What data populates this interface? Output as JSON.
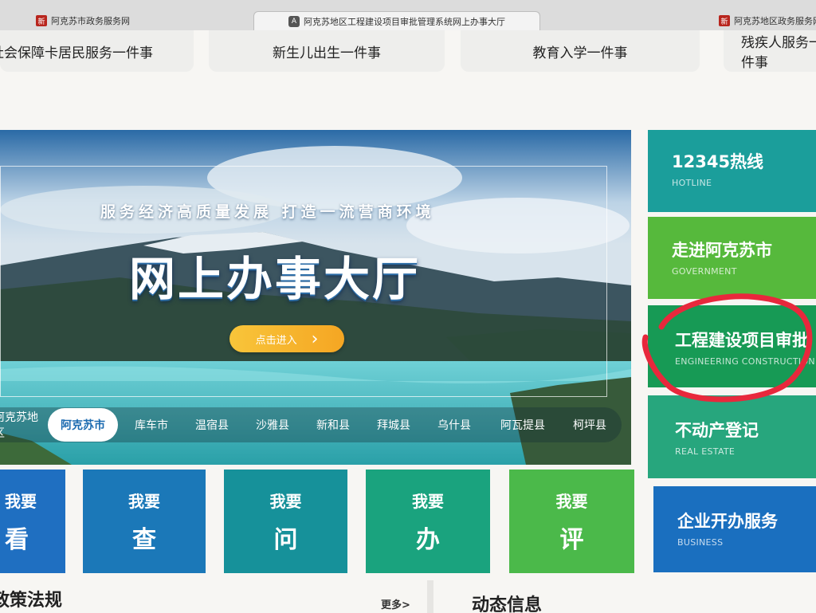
{
  "browser": {
    "tabs": [
      {
        "label": "阿克苏市政务服务网",
        "favicon": "xin-logo-red"
      },
      {
        "label": "阿克苏地区工程建设项目审批管理系统网上办事大厅",
        "favicon": "A-icon"
      },
      {
        "label": "阿克苏地区政务服务网",
        "favicon": "xin-logo-red"
      }
    ]
  },
  "top_cards": [
    "社会保障卡居民服务一件事",
    "新生儿出生一件事",
    "教育入学一件事",
    "残疾人服务一件事"
  ],
  "banner": {
    "slogan": "服务经济高质量发展  打造一流营商环境",
    "title": "网上办事大厅",
    "enter_button": "点击进入",
    "enter_arrow": "›"
  },
  "regions": [
    "阿克苏地区",
    "阿克苏市",
    "库车市",
    "温宿县",
    "沙雅县",
    "新和县",
    "拜城县",
    "乌什县",
    "阿瓦提县",
    "柯坪县"
  ],
  "active_region": "阿克苏市",
  "tiles": [
    {
      "line1": "我要",
      "line2": "看",
      "color": "#1f6fc1"
    },
    {
      "line1": "我要",
      "line2": "查",
      "color": "#1b78b8"
    },
    {
      "line1": "我要",
      "line2": "问",
      "color": "#16919a"
    },
    {
      "line1": "我要",
      "line2": "办",
      "color": "#1aa37e"
    },
    {
      "line1": "我要",
      "line2": "评",
      "color": "#4bb94a"
    }
  ],
  "right_cards": [
    {
      "title": "12345热线",
      "subtitle": "HOTLINE",
      "color": "#1b9e9b"
    },
    {
      "title": "走进阿克苏市",
      "subtitle": "GOVERNMENT",
      "color": "#56b93c"
    },
    {
      "title": "工程建设项目审批",
      "subtitle": "ENGINEERING CONSTRUCTION",
      "color": "#179a55"
    },
    {
      "title": "不动产登记",
      "subtitle": "REAL ESTATE",
      "color": "#27a67d"
    },
    {
      "title": "企业开办服务",
      "subtitle": "BUSINESS",
      "color": "#1a6fbf"
    }
  ],
  "bottom": {
    "left_title": "政策法规",
    "more": "更多>",
    "right_title": "动态信息"
  },
  "annotation_color": "#e8283c"
}
